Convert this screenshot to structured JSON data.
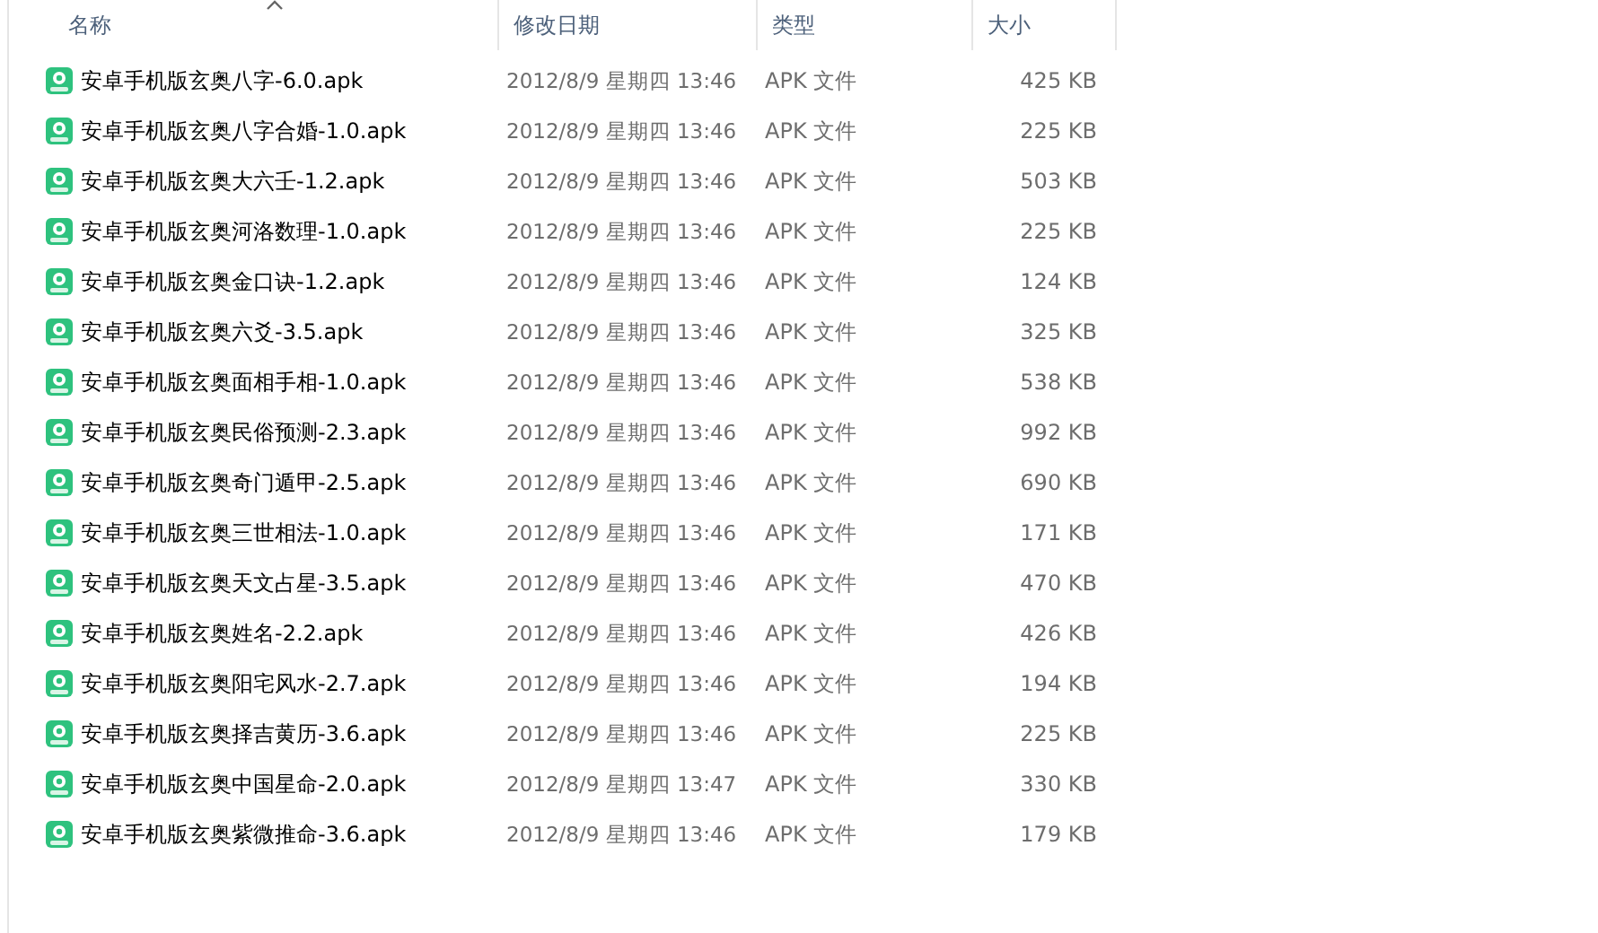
{
  "columns": [
    {
      "label": "名称",
      "sorted": true
    },
    {
      "label": "修改日期",
      "sorted": false
    },
    {
      "label": "类型",
      "sorted": false
    },
    {
      "label": "大小",
      "sorted": false
    }
  ],
  "rows": [
    {
      "name": "安卓手机版玄奥八字-6.0.apk",
      "date": "2012/8/9 星期四 13:46",
      "type": "APK 文件",
      "size": "425 KB"
    },
    {
      "name": "安卓手机版玄奥八字合婚-1.0.apk",
      "date": "2012/8/9 星期四 13:46",
      "type": "APK 文件",
      "size": "225 KB"
    },
    {
      "name": "安卓手机版玄奥大六壬-1.2.apk",
      "date": "2012/8/9 星期四 13:46",
      "type": "APK 文件",
      "size": "503 KB"
    },
    {
      "name": "安卓手机版玄奥河洛数理-1.0.apk",
      "date": "2012/8/9 星期四 13:46",
      "type": "APK 文件",
      "size": "225 KB"
    },
    {
      "name": "安卓手机版玄奥金口诀-1.2.apk",
      "date": "2012/8/9 星期四 13:46",
      "type": "APK 文件",
      "size": "124 KB"
    },
    {
      "name": "安卓手机版玄奥六爻-3.5.apk",
      "date": "2012/8/9 星期四 13:46",
      "type": "APK 文件",
      "size": "325 KB"
    },
    {
      "name": "安卓手机版玄奥面相手相-1.0.apk",
      "date": "2012/8/9 星期四 13:46",
      "type": "APK 文件",
      "size": "538 KB"
    },
    {
      "name": "安卓手机版玄奥民俗预测-2.3.apk",
      "date": "2012/8/9 星期四 13:46",
      "type": "APK 文件",
      "size": "992 KB"
    },
    {
      "name": "安卓手机版玄奥奇门遁甲-2.5.apk",
      "date": "2012/8/9 星期四 13:46",
      "type": "APK 文件",
      "size": "690 KB"
    },
    {
      "name": "安卓手机版玄奥三世相法-1.0.apk",
      "date": "2012/8/9 星期四 13:46",
      "type": "APK 文件",
      "size": "171 KB"
    },
    {
      "name": "安卓手机版玄奥天文占星-3.5.apk",
      "date": "2012/8/9 星期四 13:46",
      "type": "APK 文件",
      "size": "470 KB"
    },
    {
      "name": "安卓手机版玄奥姓名-2.2.apk",
      "date": "2012/8/9 星期四 13:46",
      "type": "APK 文件",
      "size": "426 KB"
    },
    {
      "name": "安卓手机版玄奥阳宅风水-2.7.apk",
      "date": "2012/8/9 星期四 13:46",
      "type": "APK 文件",
      "size": "194 KB"
    },
    {
      "name": "安卓手机版玄奥择吉黄历-3.6.apk",
      "date": "2012/8/9 星期四 13:46",
      "type": "APK 文件",
      "size": "225 KB"
    },
    {
      "name": "安卓手机版玄奥中国星命-2.0.apk",
      "date": "2012/8/9 星期四 13:47",
      "type": "APK 文件",
      "size": "330 KB"
    },
    {
      "name": "安卓手机版玄奥紫微推命-3.6.apk",
      "date": "2012/8/9 星期四 13:46",
      "type": "APK 文件",
      "size": "179 KB"
    }
  ]
}
